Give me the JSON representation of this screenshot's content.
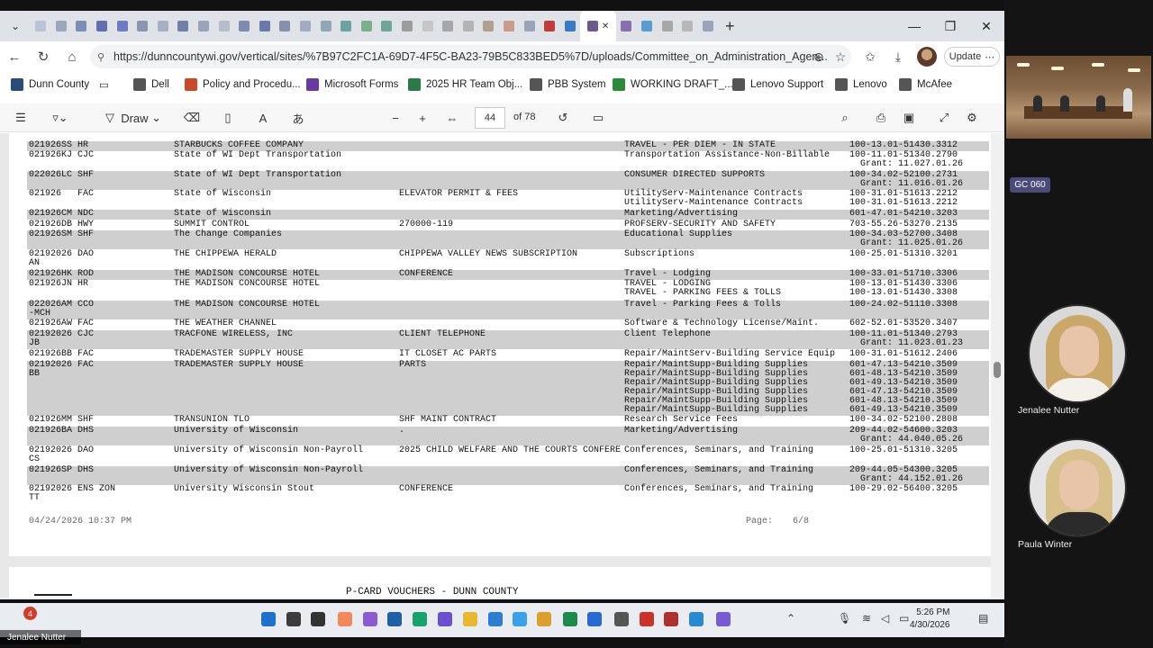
{
  "browser": {
    "url": "https://dunncountywi.gov/vertical/sites/%7B97C2FC1A-69D7-4F5C-BA23-79B5C833BED5%7D/uploads/Committee_on_Administration_Agen...",
    "update_label": "Update",
    "bookmarks": [
      "Dunn County",
      "Dell",
      "Policy and Procedu...",
      "Microsoft Forms",
      "2025 HR Team Obj...",
      "PBB System",
      "WORKING DRAFT_...",
      "Lenovo Support",
      "Lenovo",
      "McAfee"
    ]
  },
  "pdf_toolbar": {
    "draw_label": "Draw",
    "page_number": "44",
    "page_total": "of 78"
  },
  "document": {
    "rows": [
      {
        "id": "021926SS",
        "dept": "HR",
        "vendor": "STARBUCKS COFFEE COMPANY",
        "desc": "",
        "acct": "TRAVEL - PER DIEM - IN STATE",
        "gl": "100-13.01-51430.3312"
      },
      {
        "id": "021926KJ",
        "dept": "CJC",
        "vendor": "State of WI Dept Transportation",
        "desc": "",
        "acct": "Transportation Assistance-Non-Billable",
        "gl": "100-11.01-51340.2790\n  Grant: 11.027.01.26"
      },
      {
        "id": "022026LC",
        "dept": "SHF",
        "vendor": "State of WI Dept Transportation",
        "desc": "",
        "acct": "CONSUMER DIRECTED SUPPORTS",
        "gl": "100-34.02-52100.2731\n  Grant: 11.016.01.26"
      },
      {
        "id": "021926",
        "dept": "FAC",
        "vendor": "State of Wisconsin",
        "desc": "ELEVATOR PERMIT & FEES",
        "acct": "UtilityServ-Maintenance Contracts\nUtilityServ-Maintenance Contracts",
        "gl": "100-31.01-51613.2212\n100-31.01-51613.2212"
      },
      {
        "id": "021926CM",
        "dept": "NDC",
        "vendor": "State of Wisconsin",
        "desc": "",
        "acct": "Marketing/Advertising",
        "gl": "601-47.01-54210.3203"
      },
      {
        "id": "021926DB",
        "dept": "HWY",
        "vendor": "SUMMIT CONTROL",
        "desc": "270000-119",
        "acct": "PROFSERV-SECURITY AND SAFETY",
        "gl": "703-55.26-53270.2135"
      },
      {
        "id": "021926SM",
        "dept": "SHF",
        "vendor": "The Change Companies",
        "desc": "",
        "acct": "Educational Supplies",
        "gl": "100-34.03-52700.3408\n  Grant: 11.025.01.26"
      },
      {
        "id": "02192026 DAO\nAN",
        "dept": "",
        "vendor": "THE CHIPPEWA HERALD",
        "desc": "CHIPPEWA VALLEY NEWS SUBSCRIPTION",
        "acct": "Subscriptions",
        "gl": "100-25.01-51310.3201"
      },
      {
        "id": "021926HK",
        "dept": "ROD",
        "vendor": "THE MADISON CONCOURSE HOTEL",
        "desc": "CONFERENCE",
        "acct": "Travel - Lodging",
        "gl": "100-33.01-51710.3306"
      },
      {
        "id": "021926JN",
        "dept": "HR",
        "vendor": "THE MADISON CONCOURSE HOTEL",
        "desc": "",
        "acct": "TRAVEL - LODGING\nTRAVEL - PARKING FEES & TOLLS",
        "gl": "100-13.01-51430.3306\n100-13.01-51430.3308"
      },
      {
        "id": "022026AM CCO\n-MCH",
        "dept": "",
        "vendor": "THE MADISON CONCOURSE HOTEL",
        "desc": "",
        "acct": "Travel - Parking Fees & Tolls",
        "gl": "100-24.02-51110.3308"
      },
      {
        "id": "021926AW",
        "dept": "FAC",
        "vendor": "THE WEATHER CHANNEL",
        "desc": "",
        "acct": "Software & Technology License/Maint.",
        "gl": "602-52.01-53520.3407"
      },
      {
        "id": "02192026 CJC\nJB",
        "dept": "",
        "vendor": "TRACFONE WIRELESS, INC",
        "desc": "CLIENT TELEPHONE",
        "acct": "Client Telephone",
        "gl": "100-11.01-51340.2793\n  Grant: 11.023.01.23"
      },
      {
        "id": "021926BB",
        "dept": "FAC",
        "vendor": "TRADEMASTER SUPPLY HOUSE",
        "desc": "IT CLOSET AC PARTS",
        "acct": "Repair/MaintServ-Building Service Equip",
        "gl": "100-31.01-51612.2406"
      },
      {
        "id": "02192026 FAC\nBB",
        "dept": "",
        "vendor": "TRADEMASTER SUPPLY HOUSE",
        "desc": "PARTS",
        "acct": "Repair/MaintSupp-Building Supplies\nRepair/MaintSupp-Building Supplies\nRepair/MaintSupp-Building Supplies\nRepair/MaintSupp-Building Supplies\nRepair/MaintSupp-Building Supplies\nRepair/MaintSupp-Building Supplies",
        "gl": "601-47.13-54210.3509\n601-48.13-54210.3509\n601-49.13-54210.3509\n601-47.13-54210.3509\n601-48.13-54210.3509\n601-49.13-54210.3509"
      },
      {
        "id": "021926MM",
        "dept": "SHF",
        "vendor": "TRANSUNION TLO",
        "desc": "SHF MAINT CONTRACT",
        "acct": "Research Service Fees",
        "gl": "100-34.02-52100.2808"
      },
      {
        "id": "021926BA",
        "dept": "DHS",
        "vendor": "University of Wisconsin",
        "desc": ".",
        "acct": "Marketing/Advertising",
        "gl": "209-44.02-54600.3203\n  Grant: 44.040.05.26"
      },
      {
        "id": "02192026 DAO\nCS",
        "dept": "",
        "vendor": "University of Wisconsin Non-Payroll",
        "desc": "2025 CHILD WELFARE AND THE COURTS CONFERE",
        "acct": "Conferences, Seminars, and Training",
        "gl": "100-25.01-51310.3205"
      },
      {
        "id": "021926SP",
        "dept": "DHS",
        "vendor": "University of Wisconsin Non-Payroll",
        "desc": "",
        "acct": "Conferences, Seminars, and Training",
        "gl": "209-44.05-54300.3205\n  Grant: 44.152.01.26"
      },
      {
        "id": "02192026 ENS ZON\nTT",
        "dept": "",
        "vendor": "University Wisconsin Stout",
        "desc": "CONFERENCE",
        "acct": "Conferences, Seminars, and Training",
        "gl": "100-29.02-56400.3205"
      }
    ],
    "footer_date": "04/24/2026 10:37 PM",
    "footer_page_label": "Page:",
    "footer_page_value": "6/8",
    "next_page_title": "P-CARD VOUCHERS - DUNN COUNTY"
  },
  "taskbar": {
    "time": "5:26 PM",
    "date": "4/30/2026",
    "notification_count": "4"
  },
  "meeting": {
    "room_label": "GC 060",
    "participants": [
      "Jenalee Nutter",
      "Paula Winter"
    ],
    "bottom_name": "Jenalee Nutter"
  }
}
